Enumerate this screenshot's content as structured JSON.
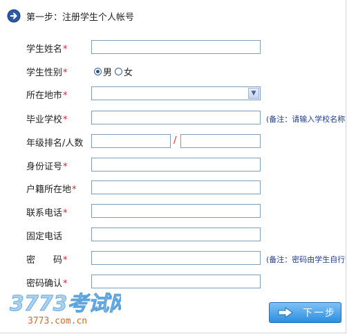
{
  "header": {
    "title": "第一步：注册学生个人帐号",
    "icon": "arrow-circle-icon"
  },
  "form": {
    "name": {
      "label": "学生姓名",
      "value": ""
    },
    "gender": {
      "label": "学生性别",
      "options": [
        "男",
        "女"
      ],
      "selected": "男"
    },
    "city": {
      "label": "所在地市",
      "selected": ""
    },
    "school": {
      "label": "毕业学校",
      "value": "",
      "note": "(备注：请输入学校名称"
    },
    "rank": {
      "label": "年级排名/人数",
      "separator": "/",
      "rank_value": "",
      "count_value": ""
    },
    "id_number": {
      "label": "身份证号",
      "value": ""
    },
    "hukou": {
      "label": "户籍所在地",
      "value": ""
    },
    "phone": {
      "label": "联系电话",
      "value": ""
    },
    "landline": {
      "label": "固定电话",
      "value": ""
    },
    "password": {
      "label": "密　　码",
      "value": "",
      "note": "(备注：密码由学生自行"
    },
    "confirm": {
      "label": "密码确认",
      "value": ""
    },
    "required_mark": "*"
  },
  "logo": {
    "main": "3773考试网",
    "sub": "3773.com.cn"
  },
  "next_button": {
    "label": "下一步"
  },
  "colors": {
    "required": "#d0252b",
    "note": "#1f3c8a",
    "button": "#2b8ee0",
    "input_border": "#7f9db9"
  }
}
